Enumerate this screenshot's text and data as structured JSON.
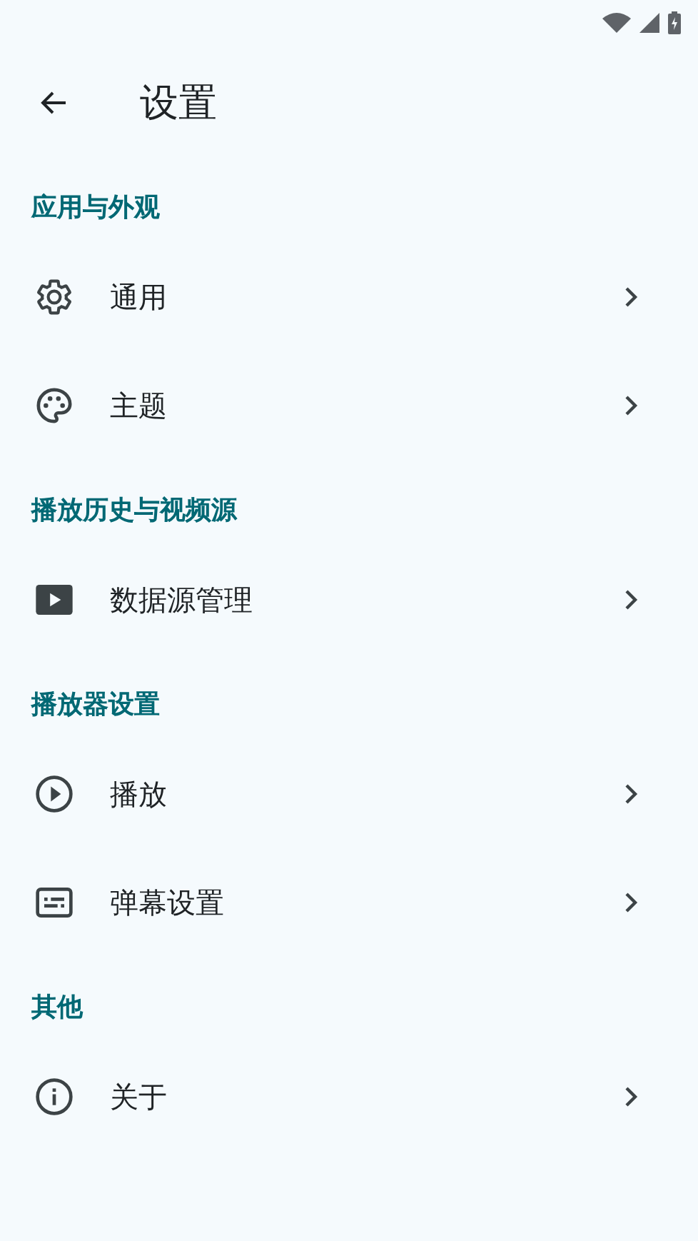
{
  "app_bar": {
    "title": "设置"
  },
  "sections": [
    {
      "title": "应用与外观",
      "items": [
        {
          "label": "通用"
        },
        {
          "label": "主题"
        }
      ]
    },
    {
      "title": "播放历史与视频源",
      "items": [
        {
          "label": "数据源管理"
        }
      ]
    },
    {
      "title": "播放器设置",
      "items": [
        {
          "label": "播放"
        },
        {
          "label": "弹幕设置"
        }
      ]
    },
    {
      "title": "其他",
      "items": [
        {
          "label": "关于"
        }
      ]
    }
  ]
}
